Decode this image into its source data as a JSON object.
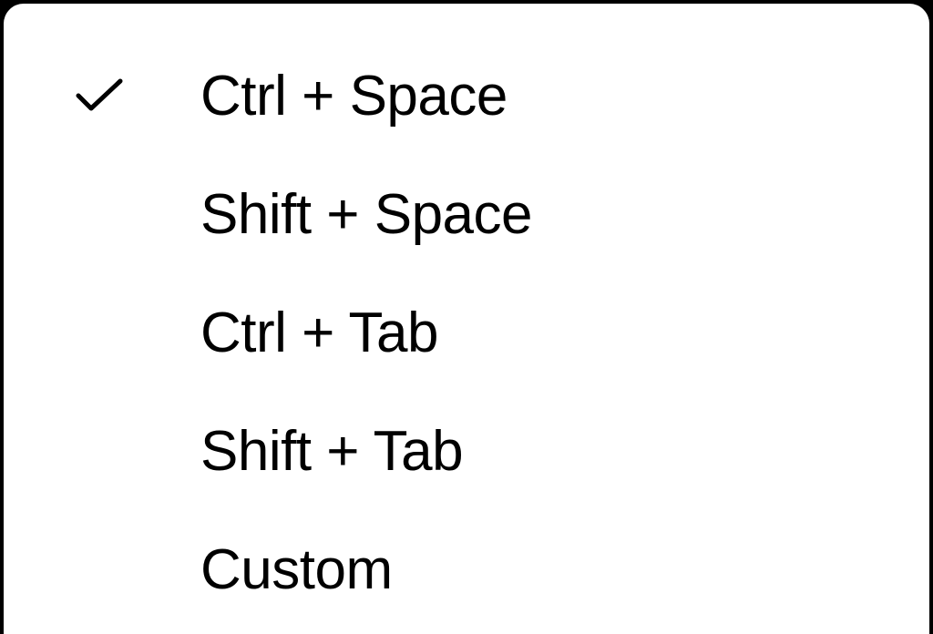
{
  "menu": {
    "items": [
      {
        "label": "Ctrl + Space",
        "selected": true
      },
      {
        "label": "Shift + Space",
        "selected": false
      },
      {
        "label": "Ctrl + Tab",
        "selected": false
      },
      {
        "label": "Shift + Tab",
        "selected": false
      },
      {
        "label": "Custom",
        "selected": false
      }
    ]
  }
}
